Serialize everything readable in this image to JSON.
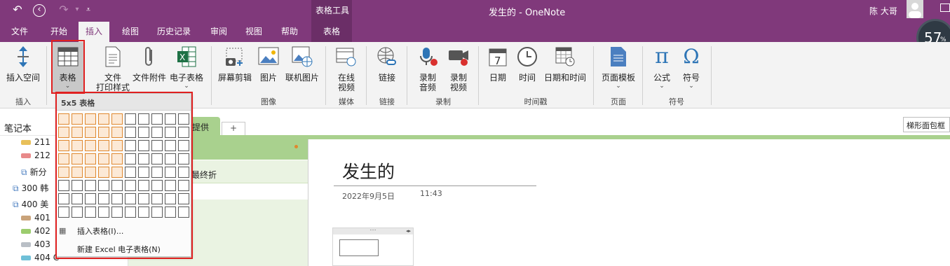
{
  "window": {
    "title": "发生的 - OneNote",
    "contextual_group": "表格工具",
    "user_name": "陈 大哥",
    "battery_percent": "57",
    "battery_unit": "%"
  },
  "tabs": [
    "文件",
    "开始",
    "插入",
    "绘图",
    "历史记录",
    "审阅",
    "视图",
    "帮助",
    "表格"
  ],
  "active_tab": "插入",
  "ribbon": {
    "insert_space": "插入空间",
    "table": "表格",
    "file_printout_1": "文件",
    "file_printout_2": "打印样式",
    "file_attachment": "文件附件",
    "spreadsheet": "电子表格",
    "screen_clipping": "屏幕剪辑",
    "picture": "图片",
    "online_picture": "联机图片",
    "online_video_1": "在线",
    "online_video_2": "视频",
    "link": "链接",
    "record_audio_1": "录制",
    "record_audio_2": "音频",
    "record_video_1": "录制",
    "record_video_2": "视频",
    "date": "日期",
    "time": "时间",
    "date_time": "日期和时间",
    "page_templates": "页面模板",
    "equation": "公式",
    "symbol": "符号",
    "calendar_day": "7",
    "groups": {
      "insert": "插入",
      "images": "图像",
      "media": "媒体",
      "links": "链接",
      "recording": "录制",
      "timestamp": "时间戳",
      "pages": "页面",
      "symbols": "符号"
    }
  },
  "table_popup": {
    "header": "5x5 表格",
    "grid_rows": 8,
    "grid_cols": 10,
    "selected_rows": 5,
    "selected_cols": 5,
    "insert_table": "插入表格(I)...",
    "new_excel": "新建 Excel 电子表格(N)"
  },
  "sidebar": {
    "title": "笔记本",
    "items": [
      {
        "label": "211",
        "color": "#e8c05a"
      },
      {
        "label": "212",
        "color": "#e88a8a"
      },
      {
        "label": "新分",
        "color": ""
      },
      {
        "label": "300 韩",
        "color": ""
      },
      {
        "label": "400 美",
        "color": ""
      },
      {
        "label": "401",
        "color": "#c9a37a"
      },
      {
        "label": "402",
        "color": "#9ccc6e"
      },
      {
        "label": "403",
        "color": "#b9bfc6"
      },
      {
        "label": "404 C",
        "color": "#6fc0d8"
      }
    ]
  },
  "section_tab": "提供",
  "add_tab": "+",
  "page_list": {
    "item": "最终折"
  },
  "search_text": "梯形面包框",
  "page": {
    "title": "发生的",
    "date": "2022年9月5日",
    "time": "11:43"
  },
  "colors": {
    "accent": "#80397b",
    "highlight": "#e0882e",
    "section": "#a9d18e"
  }
}
